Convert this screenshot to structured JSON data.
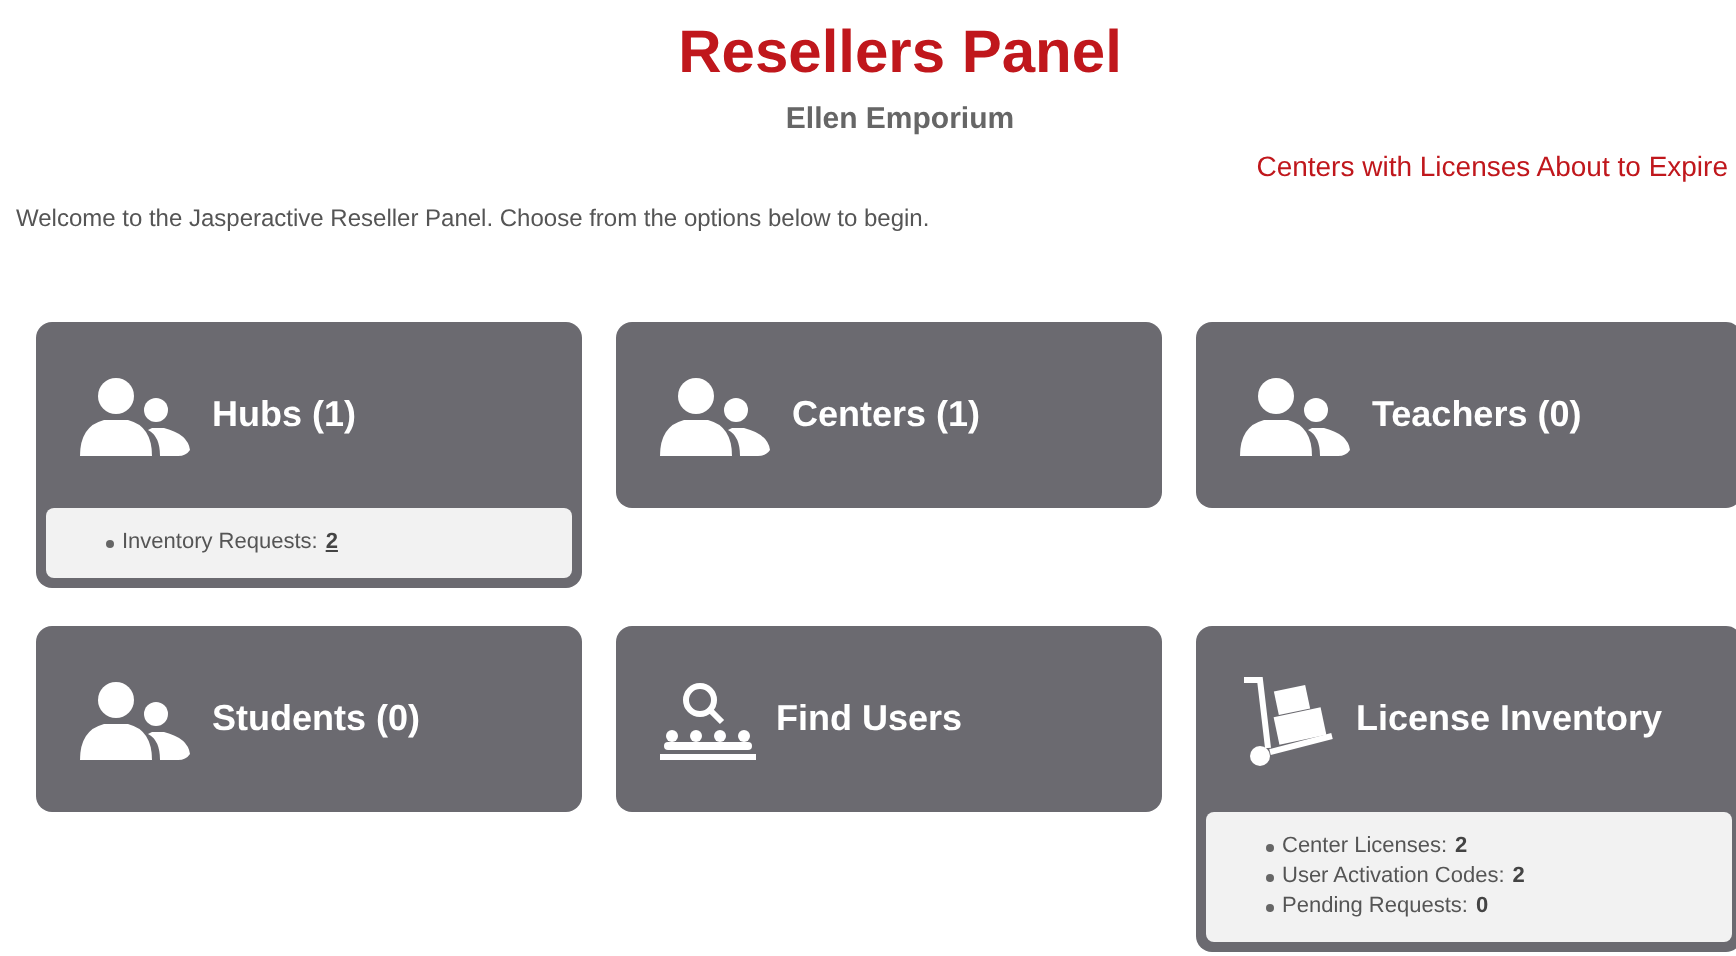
{
  "header": {
    "title": "Resellers Panel",
    "subtitle": "Ellen Emporium",
    "alert_link": "Centers with Licenses About to Expire",
    "welcome": "Welcome to the Jasperactive Reseller Panel. Choose from the options below to begin."
  },
  "tiles": [
    {
      "kind": "people",
      "title": "Hubs (1)",
      "stats": [
        {
          "label": "Inventory Requests:",
          "value": "2",
          "link": true
        }
      ]
    },
    {
      "kind": "people",
      "title": "Centers (1)"
    },
    {
      "kind": "people",
      "title": "Teachers (0)"
    },
    {
      "kind": "people",
      "title": "Students (0)"
    },
    {
      "kind": "search",
      "title": "Find Users"
    },
    {
      "kind": "cart",
      "title": "License Inventory",
      "stats": [
        {
          "label": "Center Licenses:",
          "value": "2",
          "link": false
        },
        {
          "label": "User Activation Codes:",
          "value": "2",
          "link": false
        },
        {
          "label": "Pending Requests:",
          "value": "0",
          "link": false
        }
      ]
    }
  ]
}
